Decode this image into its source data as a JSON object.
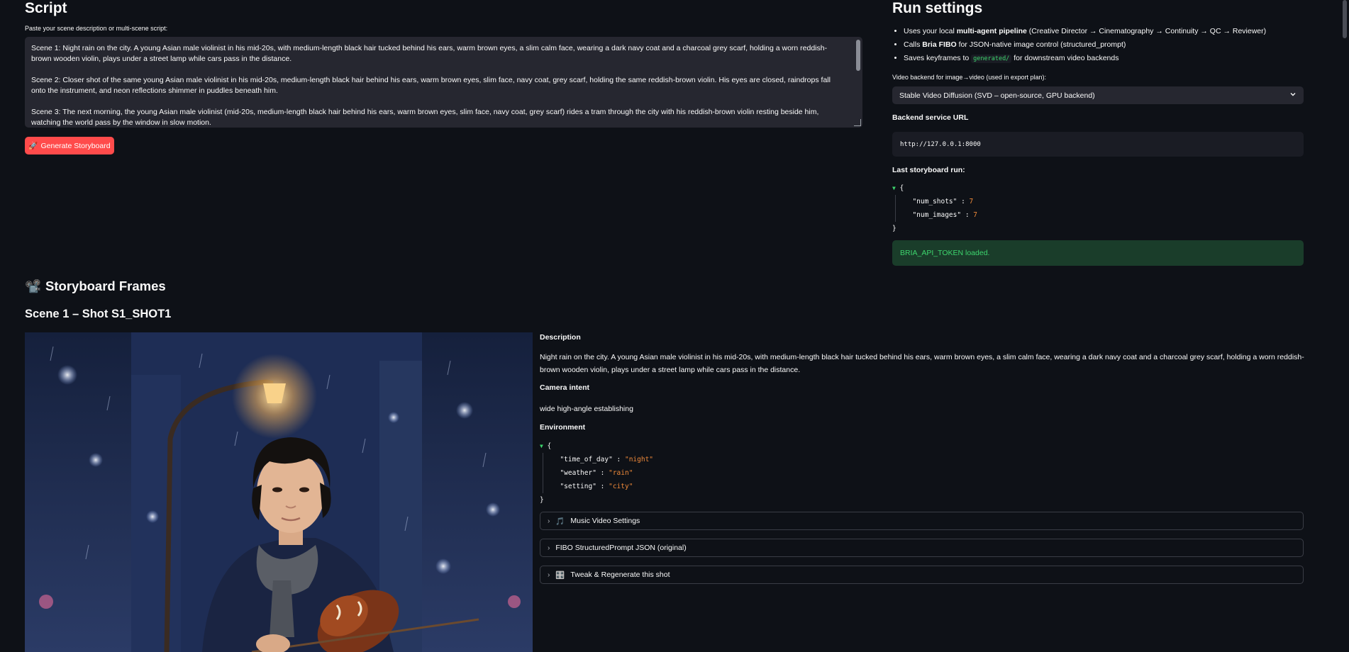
{
  "script": {
    "title": "Script",
    "textarea_label": "Paste your scene description or multi-scene script:",
    "scenes": [
      "Scene 1: Night rain on the city. A young Asian male violinist in his mid-20s, with medium-length black hair tucked behind his ears, warm brown eyes, a slim calm face, wearing a dark navy coat and a charcoal grey scarf, holding a worn reddish-brown wooden violin, plays under a street lamp while cars pass in the distance.",
      "Scene 2: Closer shot of the same young Asian male violinist in his mid-20s, medium-length black hair behind his ears, warm brown eyes, slim face, navy coat, grey scarf, holding the same reddish-brown violin. His eyes are closed, raindrops fall onto the instrument, and neon reflections shimmer in puddles beneath him.",
      "Scene 3: The next morning, the young Asian male violinist (mid-20s, medium-length black hair behind his ears, warm brown eyes, slim face, navy coat, grey scarf) rides a tram through the city with his reddish-brown violin resting beside him, watching the world pass by the window in slow motion."
    ],
    "generate_button": "Generate Storyboard",
    "generate_icon": "🚀"
  },
  "run_settings": {
    "title": "Run settings",
    "bullets": [
      {
        "pre": "Uses your local ",
        "bold": "multi-agent pipeline",
        "post": " (Creative Director → Cinematography → Continuity → QC → Reviewer)"
      },
      {
        "pre": "Calls ",
        "bold": "Bria FIBO",
        "post": " for JSON-native image control (structured_prompt)"
      },
      {
        "pre": "Saves keyframes to ",
        "code": "generated/",
        "post": " for downstream video backends"
      }
    ],
    "video_backend_label": "Video backend for image→video (used in export plan):",
    "video_backend_value": "Stable Video Diffusion (SVD – open-source, GPU backend)",
    "backend_url_label": "Backend service URL",
    "backend_url_value": "http://127.0.0.1:8000",
    "last_run_label": "Last storyboard run:",
    "last_run": {
      "num_shots_key": "\"num_shots\"",
      "num_shots": "7",
      "num_images_key": "\"num_images\"",
      "num_images": "7"
    },
    "success_message": "BRIA_API_TOKEN loaded."
  },
  "storyboard": {
    "title": "Storyboard Frames",
    "title_icon": "📽️",
    "scene_heading": "Scene 1 – Shot S1_SHOT1",
    "description_label": "Description",
    "description_text": "Night rain on the city. A young Asian male violinist in his mid-20s, with medium-length black hair tucked behind his ears, warm brown eyes, a slim calm face, wearing a dark navy coat and a charcoal grey scarf, holding a worn reddish-brown wooden violin, plays under a street lamp while cars pass in the distance.",
    "camera_intent_label": "Camera intent",
    "camera_intent_text": "wide high-angle establishing",
    "environment_label": "Environment",
    "environment": {
      "time_key": "\"time_of_day\"",
      "time_val": "\"night\"",
      "weather_key": "\"weather\"",
      "weather_val": "\"rain\"",
      "setting_key": "\"setting\"",
      "setting_val": "\"city\""
    },
    "expanders": [
      {
        "icon": "🎵",
        "label": "Music Video Settings"
      },
      {
        "icon": "",
        "label": "FIBO StructuredPrompt JSON (original)"
      },
      {
        "icon": "🎛️",
        "label": "Tweak & Regenerate this shot"
      }
    ]
  },
  "colors": {
    "background": "#0e1117",
    "primary_button": "#ff4b4b",
    "success_text": "#3dd56d",
    "json_value": "#f08a3a"
  }
}
